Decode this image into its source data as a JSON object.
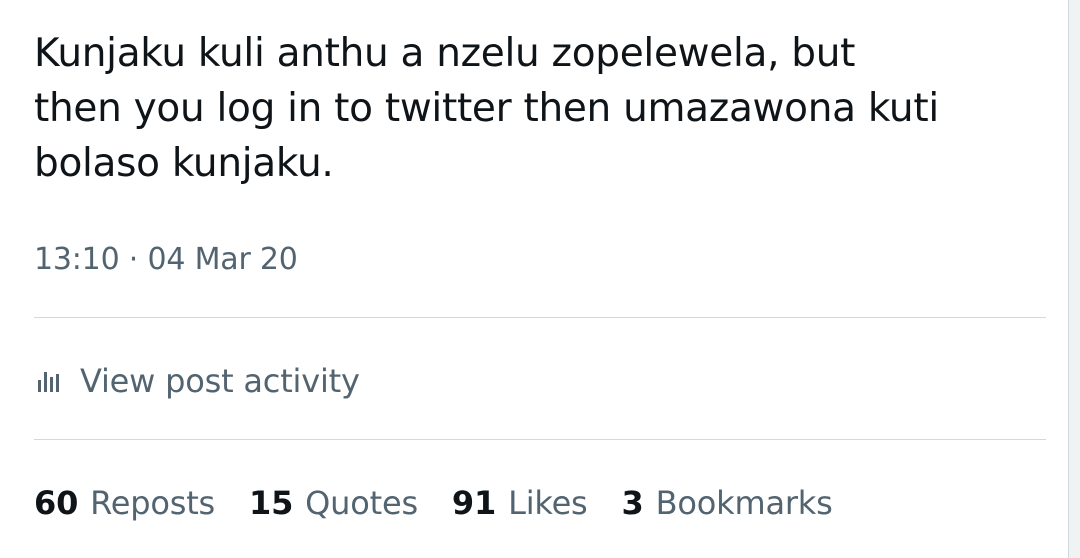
{
  "tweet": {
    "text_lines": [
      "Kunjaku kuli anthu a nzelu zopelewela, but",
      "then you log in to twitter then umazawona kuti",
      "bolaso kunjaku."
    ],
    "timestamp": "13:10 · 04 Mar 20"
  },
  "activity": {
    "icon": "bar-chart-icon",
    "label": "View post activity"
  },
  "stats": [
    {
      "count": "60",
      "label": "Reposts"
    },
    {
      "count": "15",
      "label": "Quotes"
    },
    {
      "count": "91",
      "label": "Likes"
    },
    {
      "count": "3",
      "label": "Bookmarks"
    }
  ],
  "colors": {
    "text_primary": "#0f1419",
    "text_secondary": "#536471",
    "divider": "#cfd9de",
    "background": "#ffffff"
  }
}
